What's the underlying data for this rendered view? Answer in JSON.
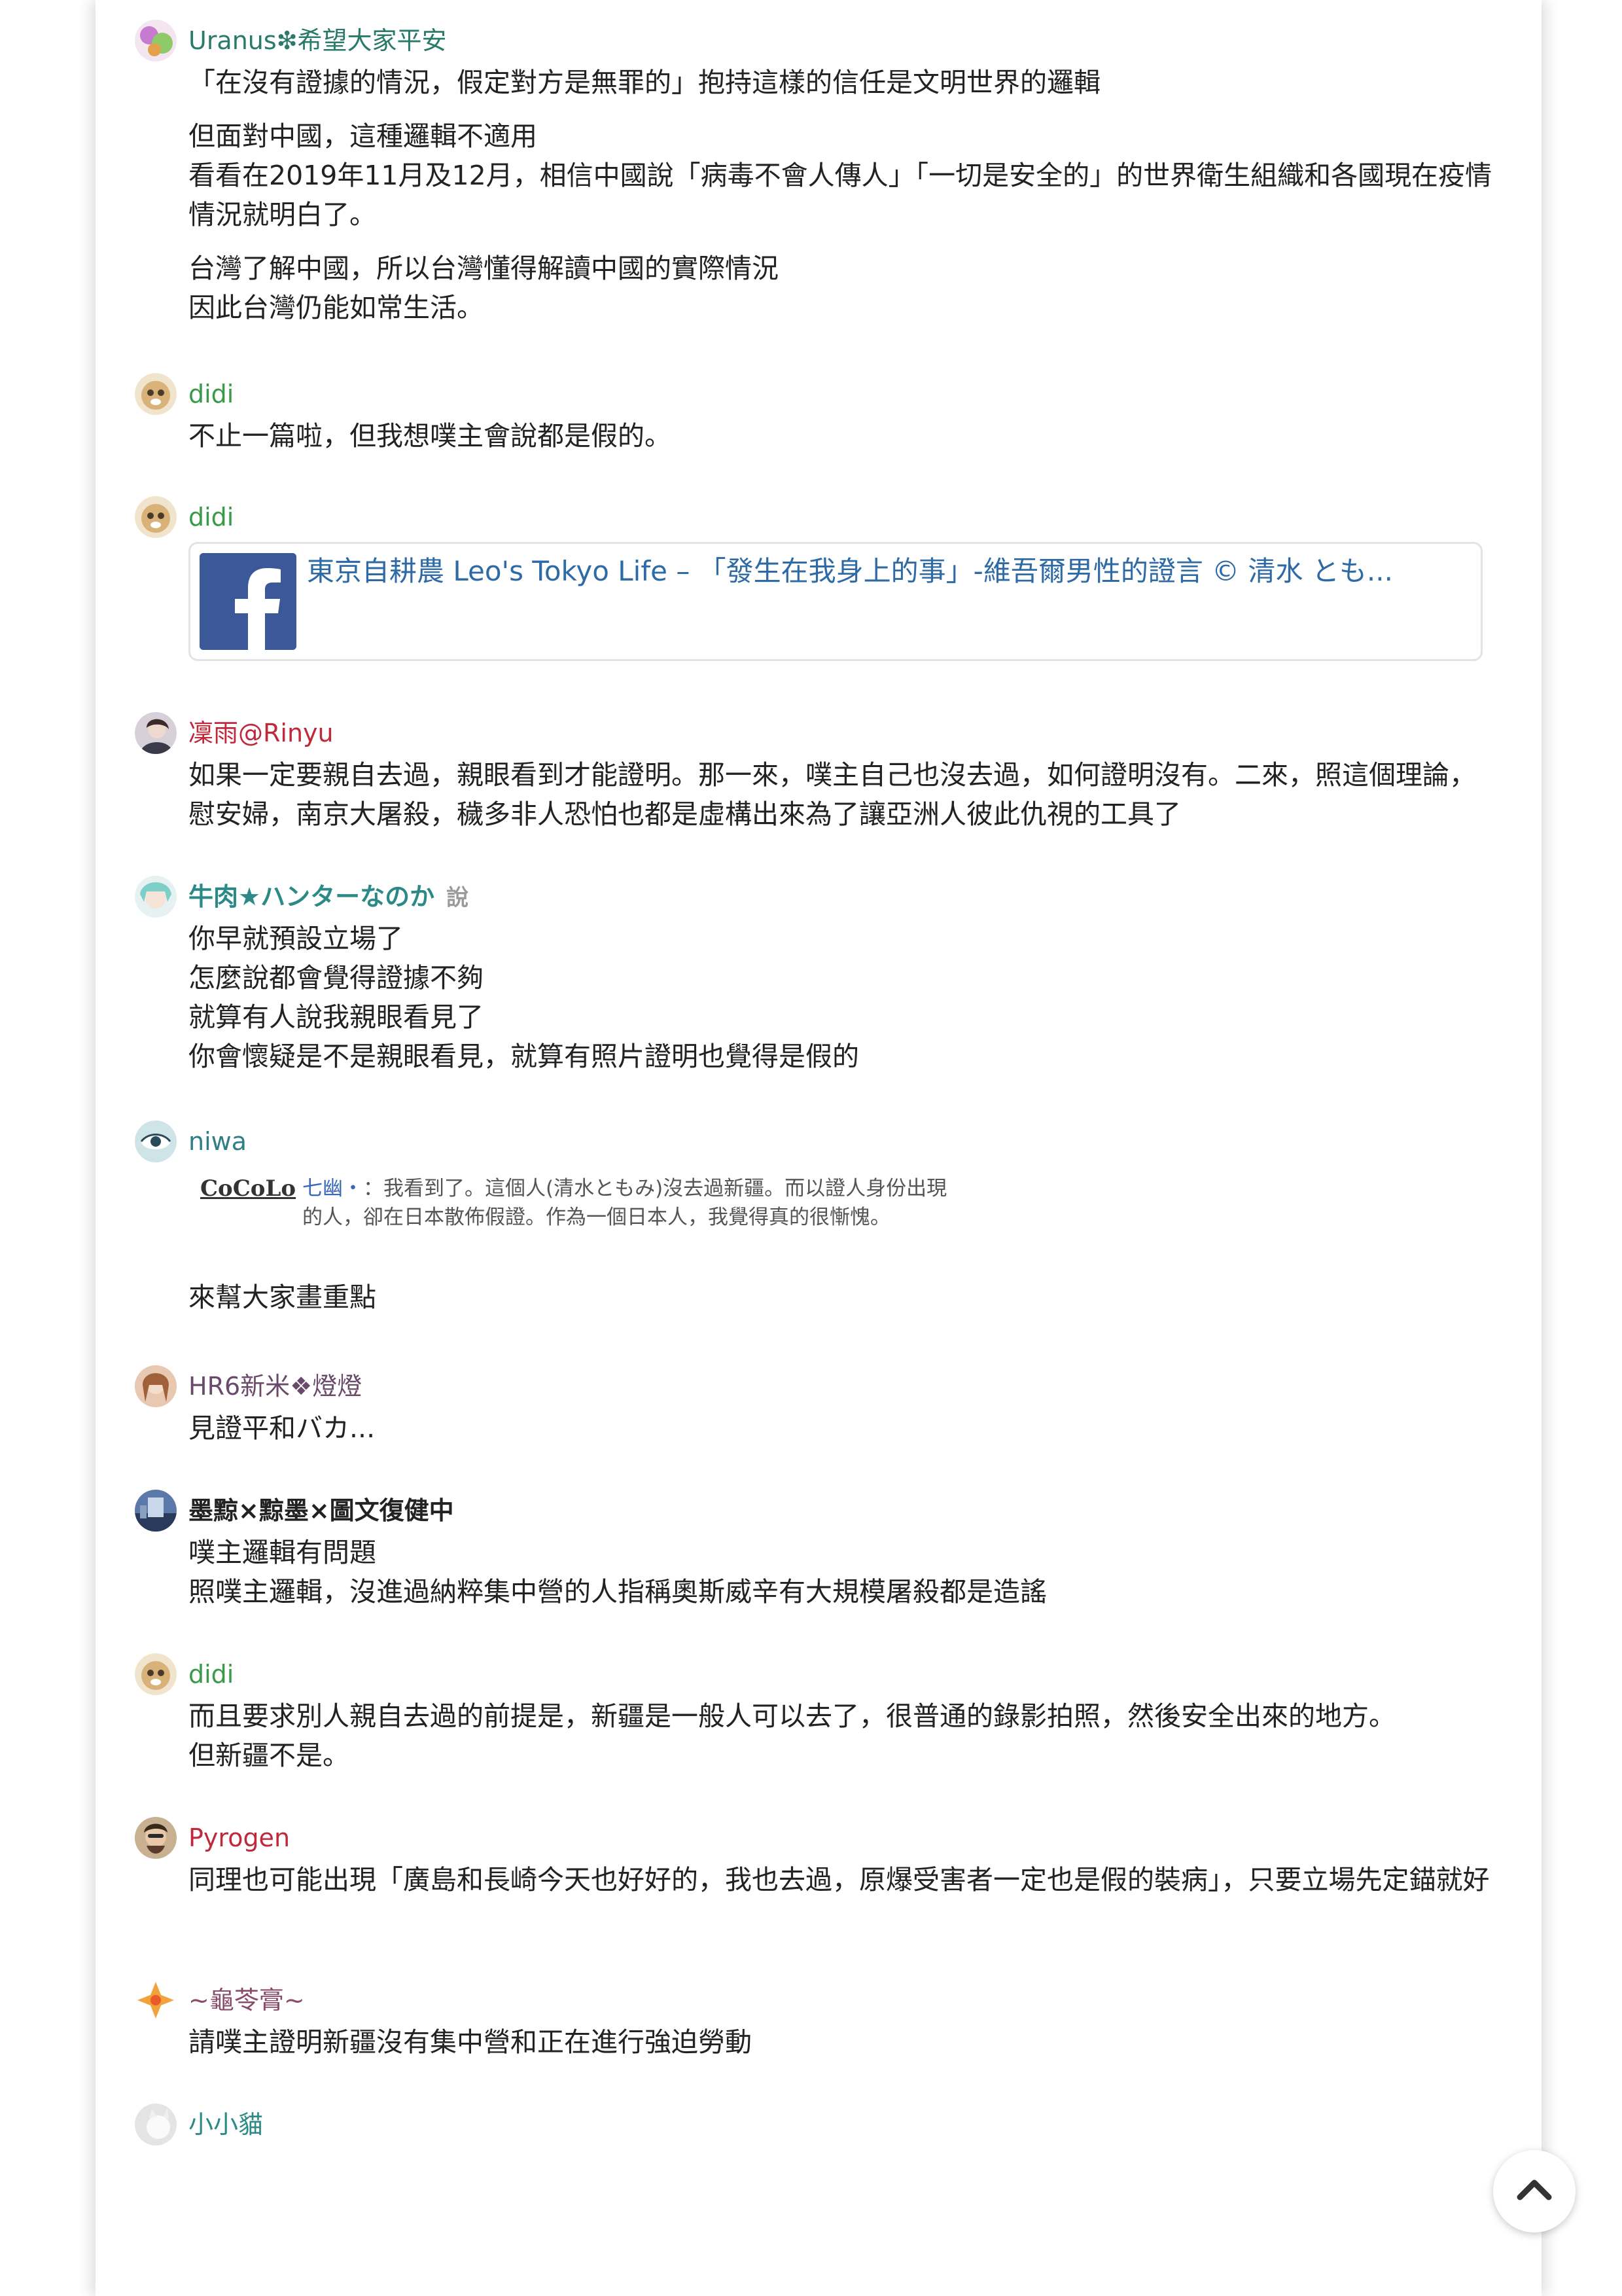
{
  "responses": [
    {
      "user": "Uranus❇希望大家平安",
      "color": "#2a7a6a",
      "lines": [
        "「在沒有證據的情況，假定對方是無罪的」抱持這樣的信任是文明世界的邏輯",
        "",
        "但面對中國，這種邏輯不適用",
        "看看在2019年11月及12月，相信中國說「病毒不會人傳人」「一切是安全的」的世界衛生組織和各國現在疫情情況就明白了。",
        "",
        "台灣了解中國，所以台灣懂得解讀中國的實際情況",
        "因此台灣仍能如常生活。"
      ]
    },
    {
      "user": "didi",
      "color": "#3a9a4a",
      "lines": [
        "不止一篇啦，但我想噗主會說都是假的。"
      ]
    },
    {
      "user": "didi",
      "color": "#3a9a4a",
      "link_title": "東京自耕農 Leo's Tokyo Life – 「發生在我身上的事」-維吾爾男性的證言 © 清水 とも..."
    },
    {
      "user": "凜雨@Rinyu",
      "color": "#c0283b",
      "lines": [
        "如果一定要親自去過，親眼看到才能證明。那一來，噗主自己也沒去過，如何證明沒有。二來，照這個理論，慰安婦，南京大屠殺，穢多非人恐怕也都是虛構出來為了讓亞洲人彼此仇視的工具了"
      ]
    },
    {
      "user": "牛肉★ハンターなのか",
      "says": "說",
      "color": "#2c8a86",
      "lines": [
        "你早就預設立場了",
        "怎麼說都會覺得證據不夠",
        "就算有人說我親眼看見了",
        "你會懷疑是不是親眼看見，就算有照片證明也覺得是假的"
      ]
    },
    {
      "user": "niwa",
      "color": "#2f7f86",
      "quote_user": "CoCoLo",
      "quote_nick": "七幽・",
      "quote_text": "：我看到了。這個人(清水ともみ)沒去過新疆。而以證人身份出現的人，卻在日本散佈假證。作為一個日本人，我覺得真的很慚愧。",
      "lines": [
        "來幫大家畫重點"
      ]
    },
    {
      "user": "HR6新米❖燈燈",
      "color": "#6a4a6a",
      "lines": [
        "見證平和バカ..."
      ]
    },
    {
      "user": "墨黥×黥墨×圖文復健中",
      "color": "#222222",
      "lines": [
        "噗主邏輯有問題",
        "照噗主邏輯，沒進過納粹集中營的人指稱奧斯威辛有大規模屠殺都是造謠"
      ]
    },
    {
      "user": "didi",
      "color": "#3a9a4a",
      "lines": [
        "而且要求別人親自去過的前提是，新疆是一般人可以去了，很普通的錄影拍照，然後安全出來的地方。",
        "但新疆不是。"
      ]
    },
    {
      "user": "Pyrogen",
      "color": "#c0283b",
      "lines": [
        "同理也可能出現「廣島和長崎今天也好好的，我也去過，原爆受害者一定也是假的裝病」，只要立場先定錨就好"
      ]
    },
    {
      "user": "~龜苓膏~",
      "color": "#8a4a6a",
      "lines": [
        "請噗主證明新疆沒有集中營和正在進行強迫勞動"
      ]
    },
    {
      "user": "小小貓",
      "color": "#2c8a86",
      "lines": []
    }
  ],
  "icons": {
    "scroll_top": "chevron-up-icon",
    "facebook": "facebook-logo-icon"
  }
}
